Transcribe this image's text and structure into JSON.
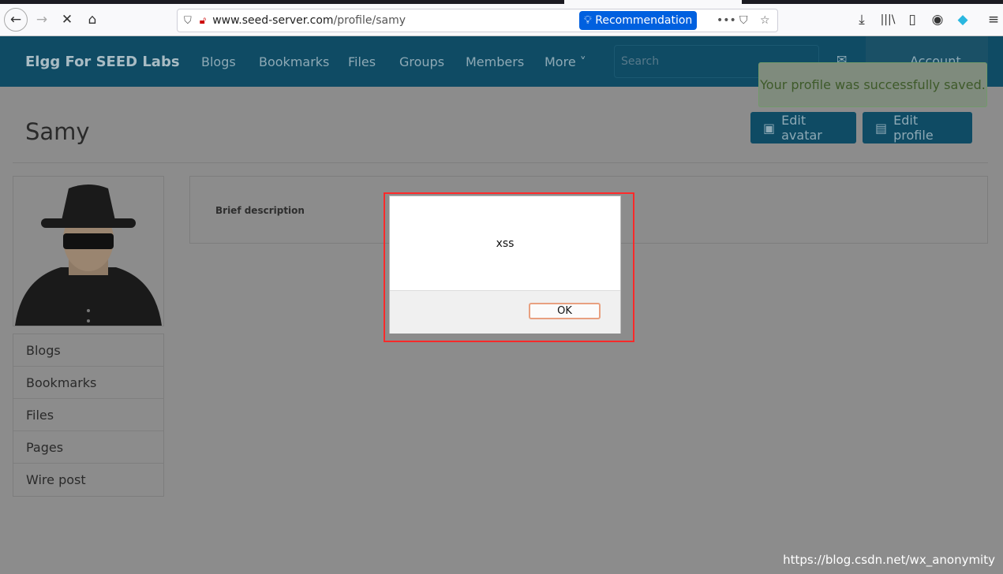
{
  "browser": {
    "url_host": "www.seed-server.com",
    "url_path": "/profile/samy",
    "recommendation": "Recommendation"
  },
  "nav": {
    "brand": "Elgg For SEED Labs",
    "items": [
      "Blogs",
      "Bookmarks",
      "Files",
      "Groups",
      "Members",
      "More ˅"
    ],
    "search_placeholder": "Search",
    "account": "Account"
  },
  "toast": "Your profile was successfully saved.",
  "profile": {
    "name": "Samy",
    "edit_avatar": "Edit avatar",
    "edit_profile": "Edit profile",
    "brief_description": "Brief description"
  },
  "sidebar": {
    "items": [
      "Blogs",
      "Bookmarks",
      "Files",
      "Pages",
      "Wire post"
    ]
  },
  "dialog": {
    "message": "xss",
    "ok": "OK"
  },
  "watermark": "https://blog.csdn.net/wx_anonymity"
}
